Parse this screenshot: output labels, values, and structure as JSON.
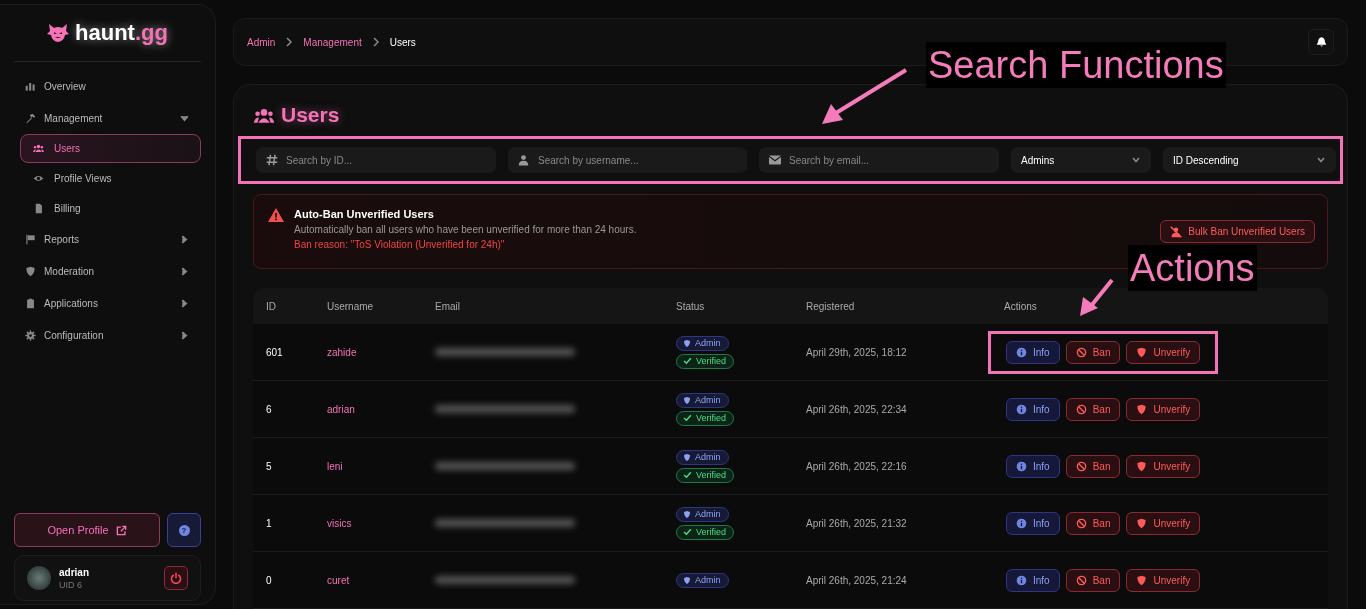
{
  "sidebar": {
    "logo": {
      "text": "haunt",
      "accent": ".gg"
    },
    "items": [
      {
        "label": "Overview",
        "kind": "link",
        "selected": false
      },
      {
        "label": "Management",
        "kind": "group",
        "expanded": true,
        "selected": false,
        "children": [
          {
            "label": "Users",
            "selected": true
          },
          {
            "label": "Profile Views",
            "selected": false
          },
          {
            "label": "Billing",
            "selected": false
          }
        ]
      },
      {
        "label": "Reports",
        "kind": "group",
        "expanded": false,
        "selected": false
      },
      {
        "label": "Moderation",
        "kind": "group",
        "expanded": false,
        "selected": false
      },
      {
        "label": "Applications",
        "kind": "group",
        "expanded": false,
        "selected": false
      },
      {
        "label": "Configuration",
        "kind": "group",
        "expanded": false,
        "selected": false
      }
    ],
    "open_profile": "Open Profile",
    "help_icon": "?",
    "user": {
      "name": "adrian",
      "uid": "UID 6"
    }
  },
  "breadcrumb": [
    {
      "label": "Admin",
      "current": false
    },
    {
      "label": "Management",
      "current": false
    },
    {
      "label": "Users",
      "current": true
    }
  ],
  "page_title": "Users",
  "filters": {
    "highlighted": true,
    "search_id": {
      "placeholder": "Search by ID..."
    },
    "search_username": {
      "placeholder": "Search by username..."
    },
    "search_email": {
      "placeholder": "Search by email..."
    },
    "role": "Admins",
    "sort": "ID Descending"
  },
  "alert": {
    "title": "Auto-Ban Unverified Users",
    "text": "Automatically ban all users who have been unverified for more than 24 hours.",
    "reason": "Ban reason: \"ToS Violation (Unverified for 24h)\"",
    "button": "Bulk Ban Unverified Users"
  },
  "table": {
    "columns": [
      "ID",
      "Username",
      "Email",
      "Status",
      "Registered",
      "Actions"
    ],
    "rows": [
      {
        "id": "601",
        "username": "zahide",
        "badges": [
          {
            "kind": "admin",
            "label": "Admin"
          },
          {
            "kind": "verified",
            "label": "Verified"
          }
        ],
        "registered": "April 29th, 2025, 18:12",
        "actions": [
          "Info",
          "Ban",
          "Unverify"
        ],
        "highlighted": true
      },
      {
        "id": "6",
        "username": "adrian",
        "badges": [
          {
            "kind": "admin",
            "label": "Admin"
          },
          {
            "kind": "verified",
            "label": "Verified"
          }
        ],
        "registered": "April 26th, 2025, 22:34",
        "actions": [
          "Info",
          "Ban",
          "Unverify"
        ],
        "highlighted": false
      },
      {
        "id": "5",
        "username": "leni",
        "badges": [
          {
            "kind": "admin",
            "label": "Admin"
          },
          {
            "kind": "verified",
            "label": "Verified"
          }
        ],
        "registered": "April 26th, 2025, 22:16",
        "actions": [
          "Info",
          "Ban",
          "Unverify"
        ],
        "highlighted": false
      },
      {
        "id": "1",
        "username": "visics",
        "badges": [
          {
            "kind": "admin",
            "label": "Admin"
          },
          {
            "kind": "verified",
            "label": "Verified"
          }
        ],
        "registered": "April 26th, 2025, 21:32",
        "actions": [
          "Info",
          "Ban",
          "Unverify"
        ],
        "highlighted": false
      },
      {
        "id": "0",
        "username": "curet",
        "badges": [
          {
            "kind": "admin",
            "label": "Admin"
          }
        ],
        "registered": "April 26th, 2025, 21:24",
        "actions": [
          "Info",
          "Ban",
          "Unverify"
        ],
        "highlighted": false
      }
    ]
  },
  "annotations": [
    {
      "text": "Search Functions"
    },
    {
      "text": "Actions"
    }
  ]
}
